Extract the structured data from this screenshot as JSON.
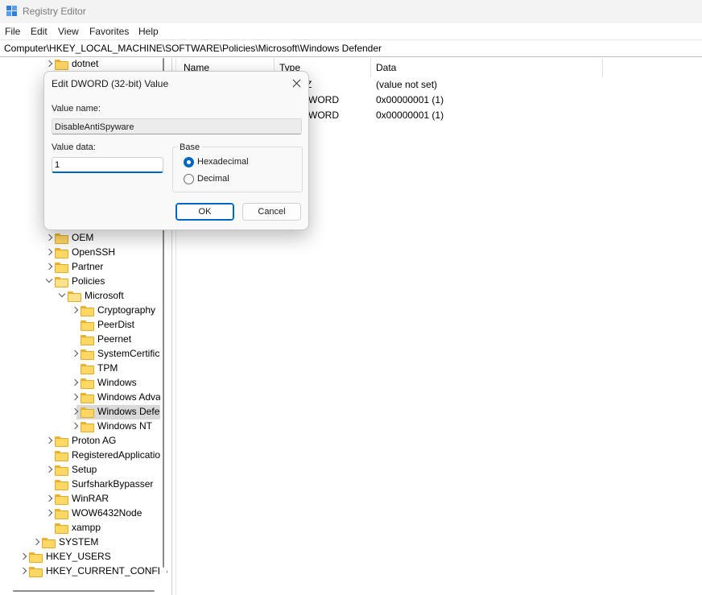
{
  "window": {
    "title": "Registry Editor"
  },
  "menu": [
    "File",
    "Edit",
    "View",
    "Favorites",
    "Help"
  ],
  "address": "Computer\\HKEY_LOCAL_MACHINE\\SOFTWARE\\Policies\\Microsoft\\Windows Defender",
  "tree": {
    "items": [
      {
        "label": "dotnet",
        "expander": "right"
      },
      {
        "label": "OEM",
        "expander": "right"
      },
      {
        "label": "OpenSSH",
        "expander": "right"
      },
      {
        "label": "Partner",
        "expander": "right"
      },
      {
        "label": "Policies",
        "expander": "down"
      },
      {
        "label": "Microsoft",
        "expander": "down"
      },
      {
        "label": "Cryptography",
        "expander": "right"
      },
      {
        "label": "PeerDist",
        "expander": "none"
      },
      {
        "label": "Peernet",
        "expander": "none"
      },
      {
        "label": "SystemCertific",
        "expander": "right"
      },
      {
        "label": "TPM",
        "expander": "none"
      },
      {
        "label": "Windows",
        "expander": "right"
      },
      {
        "label": "Windows Adva",
        "expander": "right"
      },
      {
        "label": "Windows Defe",
        "expander": "right",
        "selected": true
      },
      {
        "label": "Windows NT",
        "expander": "right"
      },
      {
        "label": "Proton AG",
        "expander": "right"
      },
      {
        "label": "RegisteredApplicatio",
        "expander": "none"
      },
      {
        "label": "Setup",
        "expander": "right"
      },
      {
        "label": "SurfsharkBypasser",
        "expander": "none"
      },
      {
        "label": "WinRAR",
        "expander": "right"
      },
      {
        "label": "WOW6432Node",
        "expander": "right"
      },
      {
        "label": "xampp",
        "expander": "none"
      },
      {
        "label": "SYSTEM",
        "expander": "right"
      },
      {
        "label": "HKEY_USERS",
        "expander": "right"
      },
      {
        "label": "HKEY_CURRENT_CONFIG",
        "expander": "right"
      }
    ]
  },
  "list": {
    "columns": [
      "Name",
      "Type",
      "Data"
    ],
    "rows": [
      {
        "type": "Z",
        "data": "(value not set)"
      },
      {
        "type": "WORD",
        "data": "0x00000001 (1)"
      },
      {
        "type": "WORD",
        "data": "0x00000001 (1)"
      }
    ]
  },
  "dialog": {
    "title": "Edit DWORD (32-bit) Value",
    "value_name_label": "Value name:",
    "value_name": "DisableAntiSpyware",
    "value_data_label": "Value data:",
    "value_data": "1",
    "base_label": "Base",
    "radio_hex": "Hexadecimal",
    "radio_dec": "Decimal",
    "selected_base": "Hexadecimal",
    "ok": "OK",
    "cancel": "Cancel"
  },
  "icons": {
    "folder_color": "#ffd763",
    "accent": "#0067c0"
  }
}
